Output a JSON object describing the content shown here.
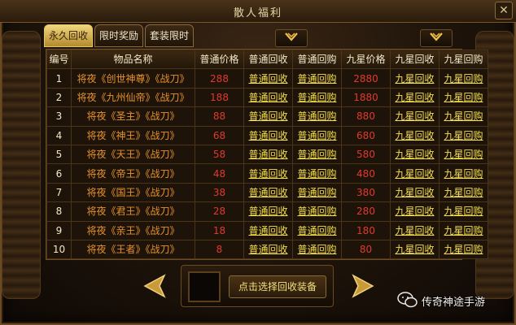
{
  "window": {
    "title": "散人福利",
    "close_label": "✕"
  },
  "tabs": [
    {
      "label": "永久回收",
      "active": true
    },
    {
      "label": "限时奖励",
      "active": false
    },
    {
      "label": "套装限时",
      "active": false
    }
  ],
  "table": {
    "headers": [
      "编号",
      "物品名称",
      "普通价格",
      "普通回收",
      "普通回购",
      "九星价格",
      "九星回收",
      "九星回购"
    ],
    "rows": [
      {
        "id": "1",
        "name": "将夜《创世神尊》《战刀》",
        "price": "288",
        "recycle": "普通回收",
        "buyback": "普通回购",
        "star_price": "2880",
        "star_recycle": "九星回收",
        "star_buyback": "九星回购"
      },
      {
        "id": "2",
        "name": "将夜《九州仙帝》《战刀》",
        "price": "188",
        "recycle": "普通回收",
        "buyback": "普通回购",
        "star_price": "1880",
        "star_recycle": "九星回收",
        "star_buyback": "九星回购"
      },
      {
        "id": "3",
        "name": "将夜《圣主》《战刀》",
        "price": "88",
        "recycle": "普通回收",
        "buyback": "普通回购",
        "star_price": "880",
        "star_recycle": "九星回收",
        "star_buyback": "九星回购"
      },
      {
        "id": "4",
        "name": "将夜《神王》《战刀》",
        "price": "68",
        "recycle": "普通回收",
        "buyback": "普通回购",
        "star_price": "680",
        "star_recycle": "九星回收",
        "star_buyback": "九星回购"
      },
      {
        "id": "5",
        "name": "将夜《天王》《战刀》",
        "price": "58",
        "recycle": "普通回收",
        "buyback": "普通回购",
        "star_price": "580",
        "star_recycle": "九星回收",
        "star_buyback": "九星回购"
      },
      {
        "id": "6",
        "name": "将夜《帝王》《战刀》",
        "price": "48",
        "recycle": "普通回收",
        "buyback": "普通回购",
        "star_price": "480",
        "star_recycle": "九星回收",
        "star_buyback": "九星回购"
      },
      {
        "id": "7",
        "name": "将夜《国王》《战刀》",
        "price": "38",
        "recycle": "普通回收",
        "buyback": "普通回购",
        "star_price": "380",
        "star_recycle": "九星回收",
        "star_buyback": "九星回购"
      },
      {
        "id": "8",
        "name": "将夜《君王》《战刀》",
        "price": "28",
        "recycle": "普通回收",
        "buyback": "普通回购",
        "star_price": "280",
        "star_recycle": "九星回收",
        "star_buyback": "九星回购"
      },
      {
        "id": "9",
        "name": "将夜《亲王》《战刀》",
        "price": "18",
        "recycle": "普通回收",
        "buyback": "普通回购",
        "star_price": "180",
        "star_recycle": "九星回收",
        "star_buyback": "九星回购"
      },
      {
        "id": "10",
        "name": "将夜《王者》《战刀》",
        "price": "8",
        "recycle": "普通回收",
        "buyback": "普通回购",
        "star_price": "80",
        "star_recycle": "九星回收",
        "star_buyback": "九星回购"
      }
    ]
  },
  "bottom": {
    "select_label": "点击选择回收装备"
  },
  "icons": {
    "prev": "arrow-left-icon",
    "next": "arrow-right-icon",
    "dropdown": "chevron-down-icon",
    "close": "close-icon",
    "watermark": "wechat-icon"
  },
  "watermark": {
    "text": "传奇神途手游"
  },
  "colors": {
    "gold": "#f5df4a",
    "item_orange": "#e8922b",
    "price_red": "#e03a2f",
    "tab_active": "#e3c467"
  }
}
